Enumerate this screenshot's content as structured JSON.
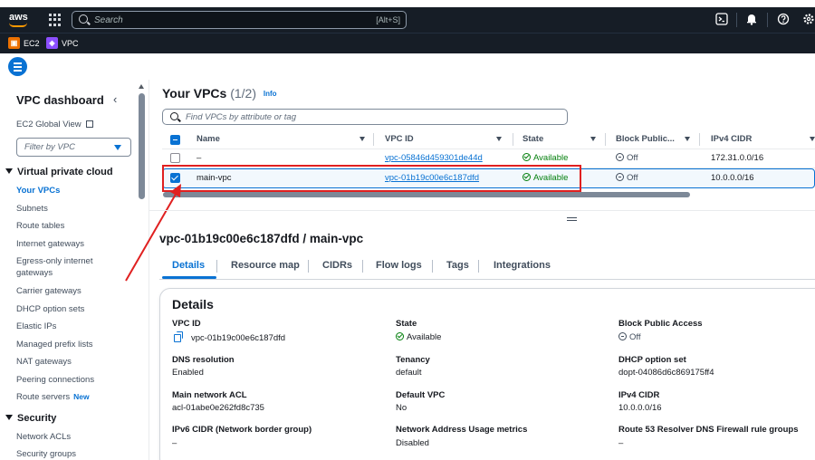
{
  "topnav": {
    "logo": "aws",
    "search_placeholder": "Search",
    "search_shortcut": "[Alt+S]",
    "icons": [
      "apps-grid-icon",
      "cloudshell-icon",
      "bell-icon",
      "help-icon",
      "gear-icon"
    ]
  },
  "servicebar": {
    "items": [
      {
        "label": "EC2",
        "color": "#ed7100"
      },
      {
        "label": "VPC",
        "color": "#8c4fff"
      }
    ]
  },
  "sidebar": {
    "title": "VPC dashboard",
    "global_view": "EC2 Global View",
    "filter_placeholder": "Filter by VPC",
    "section1": "Virtual private cloud",
    "items": [
      "Your VPCs",
      "Subnets",
      "Route tables",
      "Internet gateways",
      "Egress-only internet gateways",
      "Carrier gateways",
      "DHCP option sets",
      "Elastic IPs",
      "Managed prefix lists",
      "NAT gateways",
      "Peering connections",
      "Route servers"
    ],
    "new_badge": "New",
    "section2": "Security",
    "security_items": [
      "Network ACLs",
      "Security groups"
    ]
  },
  "table": {
    "title": "Your VPCs",
    "count": "(1/2)",
    "info": "Info",
    "find_placeholder": "Find VPCs by attribute or tag",
    "columns": [
      "Name",
      "VPC ID",
      "State",
      "Block Public...",
      "IPv4 CIDR"
    ],
    "rows": [
      {
        "name": "–",
        "vpc_id": "vpc-05846d459301de44d",
        "state": "Available",
        "block": "Off",
        "cidr": "172.31.0.0/16",
        "selected": false
      },
      {
        "name": "main-vpc",
        "vpc_id": "vpc-01b19c00e6c187dfd",
        "state": "Available",
        "block": "Off",
        "cidr": "10.0.0.0/16",
        "selected": true
      }
    ]
  },
  "detail": {
    "title": "vpc-01b19c00e6c187dfd / main-vpc",
    "tabs": [
      "Details",
      "Resource map",
      "CIDRs",
      "Flow logs",
      "Tags",
      "Integrations"
    ],
    "card_title": "Details",
    "fields": {
      "vpc_id_label": "VPC ID",
      "vpc_id": "vpc-01b19c00e6c187dfd",
      "state_label": "State",
      "state": "Available",
      "block_label": "Block Public Access",
      "block": "Off",
      "dns_label": "DNS resolution",
      "dns": "Enabled",
      "tenancy_label": "Tenancy",
      "tenancy": "default",
      "dhcp_label": "DHCP option set",
      "dhcp": "dopt-04086d6c869175ff4",
      "acl_label": "Main network ACL",
      "acl": "acl-01abe0e262fd8c735",
      "default_vpc_label": "Default VPC",
      "default_vpc": "No",
      "ipv4_label": "IPv4 CIDR",
      "ipv4": "10.0.0.0/16",
      "ipv6_label": "IPv6 CIDR (Network border group)",
      "ipv6": "–",
      "nau_label": "Network Address Usage metrics",
      "nau": "Disabled",
      "r53_label": "Route 53 Resolver DNS Firewall rule groups",
      "r53": "–"
    }
  },
  "colors": {
    "nav_bg": "#161d26",
    "link": "#0972d3",
    "success": "#037f0c",
    "annotation": "#e02020"
  }
}
